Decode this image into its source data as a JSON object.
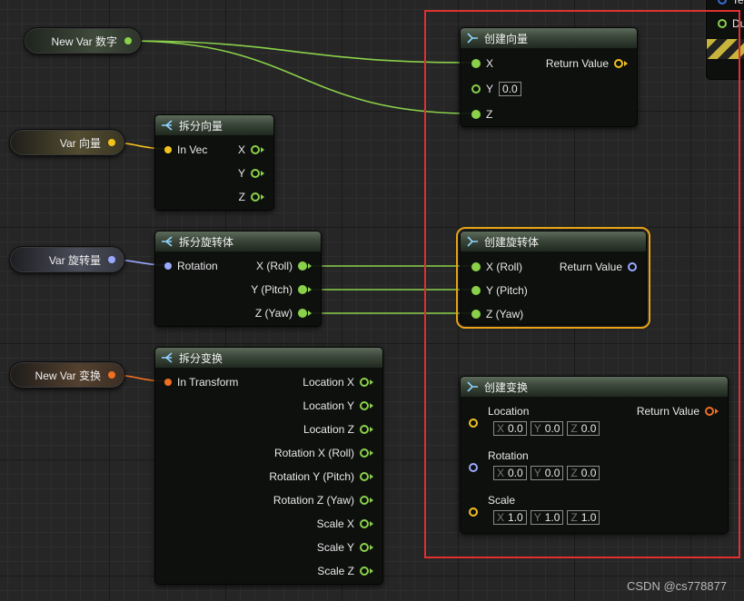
{
  "colors": {
    "float": "#8ad14a",
    "vector": "#f3c21b",
    "rotator": "#9aa9ff",
    "transform": "#f07022",
    "selected": "#e8a317",
    "highlight": "#e03030"
  },
  "vars": [
    {
      "label": "New Var 数字"
    },
    {
      "label": "Var 向量"
    },
    {
      "label": "Var 旋转量"
    },
    {
      "label": "New Var 变换"
    }
  ],
  "nodes": {
    "break_vector": {
      "title": "拆分向量",
      "input": "In Vec",
      "outputs": [
        "X",
        "Y",
        "Z"
      ]
    },
    "break_rotator": {
      "title": "拆分旋转体",
      "input": "Rotation",
      "outputs": [
        "X (Roll)",
        "Y (Pitch)",
        "Z (Yaw)"
      ]
    },
    "break_transform": {
      "title": "拆分变换",
      "input": "In Transform",
      "outputs": [
        "Location X",
        "Location Y",
        "Location Z",
        "Rotation X (Roll)",
        "Rotation Y (Pitch)",
        "Rotation Z (Yaw)",
        "Scale X",
        "Scale Y",
        "Scale Z"
      ]
    },
    "make_vector": {
      "title": "创建向量",
      "inputs": [
        "X",
        "Y",
        "Z"
      ],
      "y_value": "0.0",
      "output": "Return Value"
    },
    "make_rotator": {
      "title": "创建旋转体",
      "inputs": [
        "X (Roll)",
        "Y (Pitch)",
        "Z (Yaw)"
      ],
      "output": "Return Value"
    },
    "make_transform": {
      "title": "创建变换",
      "output": "Return Value",
      "groups": [
        {
          "label": "Location",
          "x": "0.0",
          "y": "0.0",
          "z": "0.0"
        },
        {
          "label": "Rotation",
          "x": "0.0",
          "y": "0.0",
          "z": "0.0"
        },
        {
          "label": "Scale",
          "x": "1.0",
          "y": "1.0",
          "z": "1.0"
        }
      ],
      "axis_labels": [
        "X",
        "Y",
        "Z"
      ]
    }
  },
  "corner_node_text": [
    "Te",
    "Du"
  ],
  "watermark": "CSDN @cs778877"
}
